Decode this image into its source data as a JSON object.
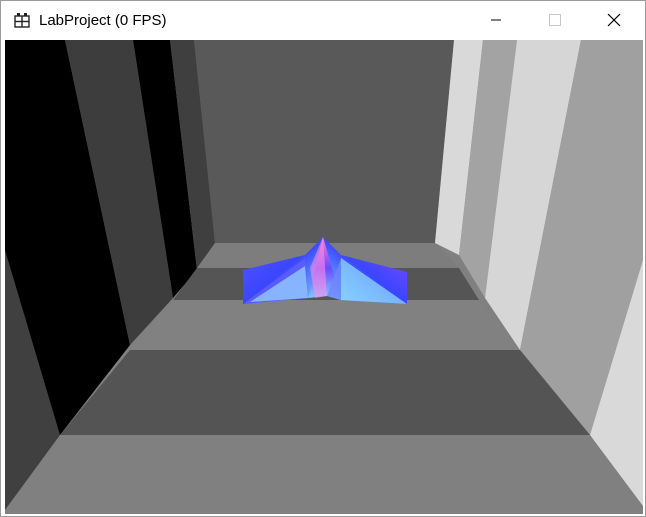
{
  "window": {
    "title": "LabProject (0 FPS)",
    "app_icon": "app-grid-icon",
    "controls": {
      "minimize_icon": "minimize-icon",
      "maximize_icon": "maximize-icon",
      "close_icon": "close-icon"
    }
  },
  "scene": {
    "description_colors": {
      "floor_light": "#808080",
      "floor_dark": "#555555",
      "back_wall": "#595959",
      "left_wall_dark": "#000000",
      "right_wall_light": "#d9d9d9"
    }
  }
}
